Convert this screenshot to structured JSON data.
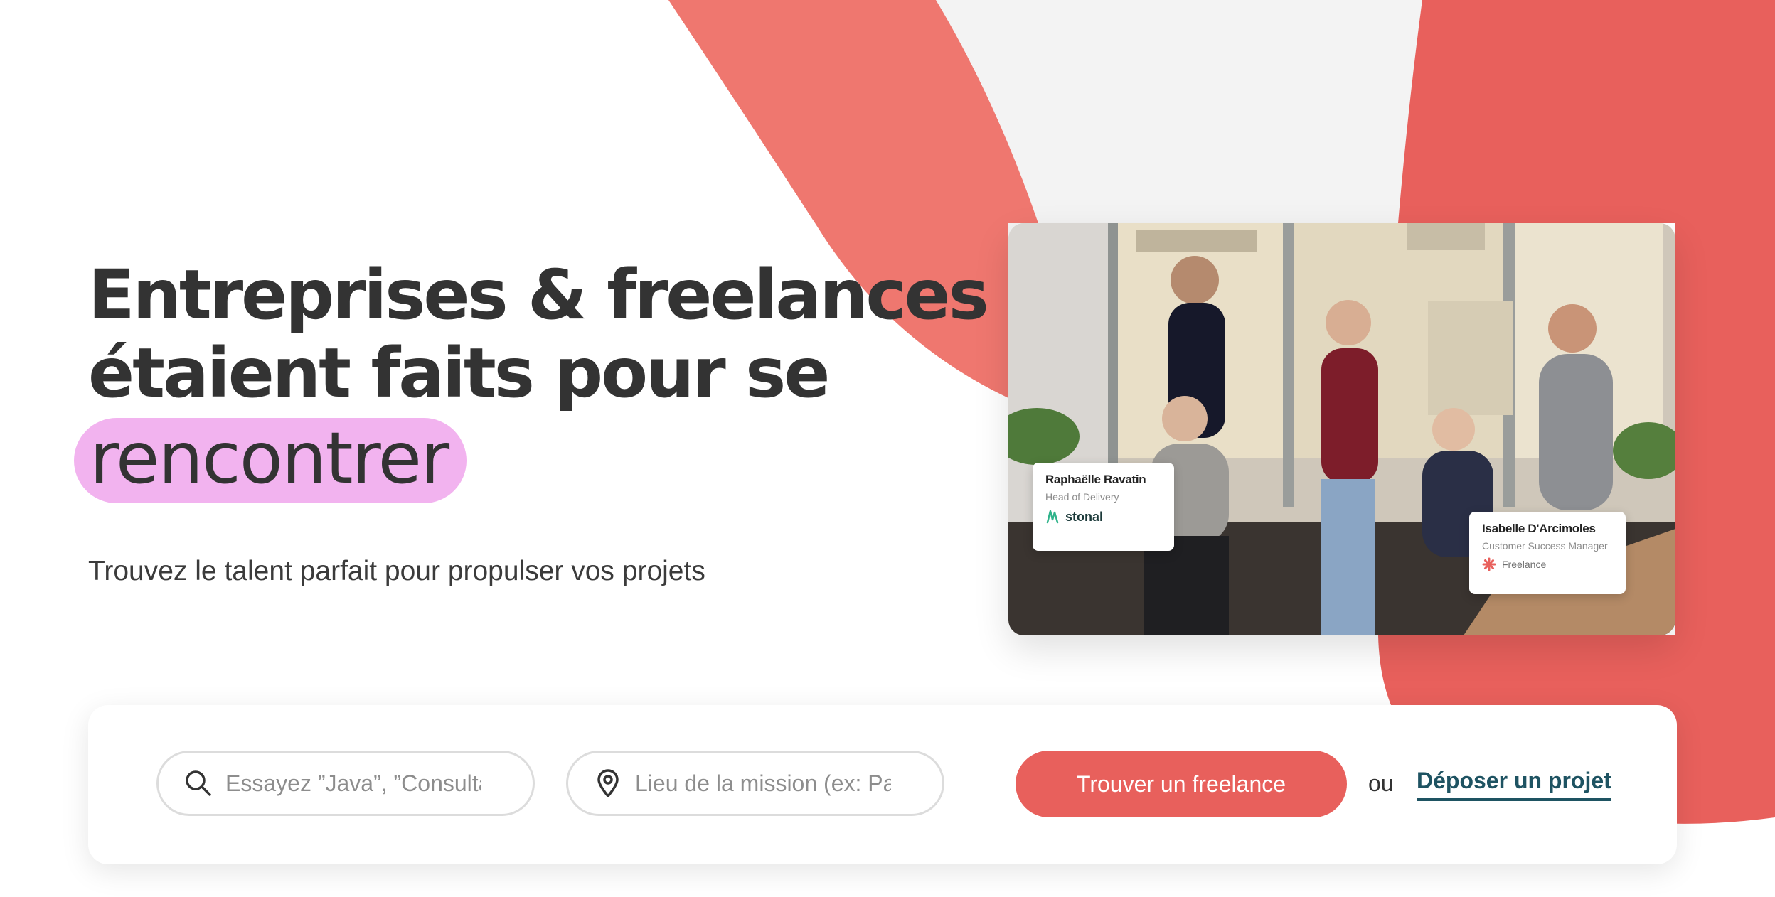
{
  "hero": {
    "title_line1": "Entreprises & freelances",
    "title_line2": "étaient faits pour se",
    "title_highlight": "rencontrer",
    "subtitle": "Trouvez le talent parfait pour propulser vos projets"
  },
  "testimonials": [
    {
      "name": "Raphaëlle Ravatin",
      "role": "Head of Delivery",
      "company": "stonal"
    },
    {
      "name": "Isabelle D'Arcimoles",
      "role": "Customer Success Manager",
      "company": "Freelance"
    }
  ],
  "search": {
    "keyword_placeholder": "Essayez ”Java”, ”Consultant”…",
    "location_placeholder": "Lieu de la mission (ex: Paris)",
    "submit_label": "Trouver un freelance",
    "or_label": "ou",
    "post_project_label": "Déposer un projet"
  },
  "colors": {
    "accent": "#e8605c",
    "highlight": "#f2b3ef",
    "link": "#1e5362"
  },
  "icons": [
    "search-icon",
    "location-pin-icon",
    "stonal-logo-icon",
    "freelance-logo-icon"
  ]
}
